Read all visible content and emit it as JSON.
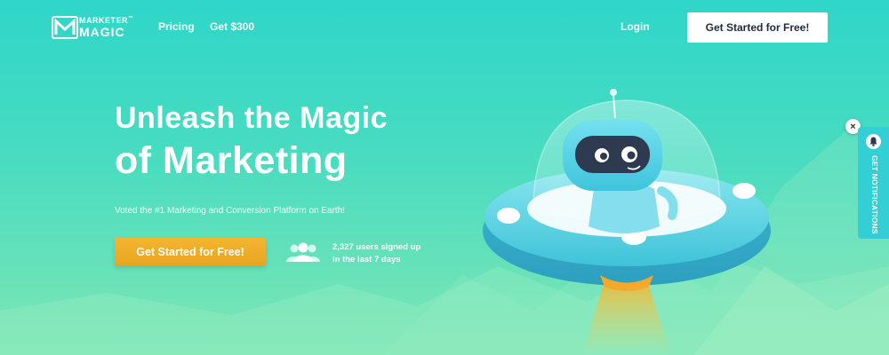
{
  "nav": {
    "logo_line1": "MARKETER",
    "logo_tm": "™",
    "logo_line2": "MAGIC",
    "links": [
      "Pricing",
      "Get $300"
    ],
    "login": "Login",
    "cta": "Get Started for Free!"
  },
  "hero": {
    "title_line1": "Unleash the Magic",
    "title_line2": "of Marketing",
    "subtitle": "Voted the #1 Marketing and Conversion Platform on Earth!",
    "cta": "Get Started for Free!",
    "users_line1": "2,327 users signed up",
    "users_line2": "in the last 7 days"
  },
  "notifications": {
    "close": "×",
    "label": "GET NOTIFICATIONS"
  },
  "icons": {
    "logo": "marketer-magic-logo-icon",
    "users": "users-group-icon",
    "robot": "robot-ufo-illustration-icon",
    "bell": "bell-icon",
    "close": "close-icon"
  },
  "colors": {
    "bg_top": "#2fd6c9",
    "bg_bottom": "#7fe6b4",
    "cta_orange": "#f4b531",
    "notif_tab": "#33cfd5",
    "dark_text": "#1f2a3a"
  }
}
